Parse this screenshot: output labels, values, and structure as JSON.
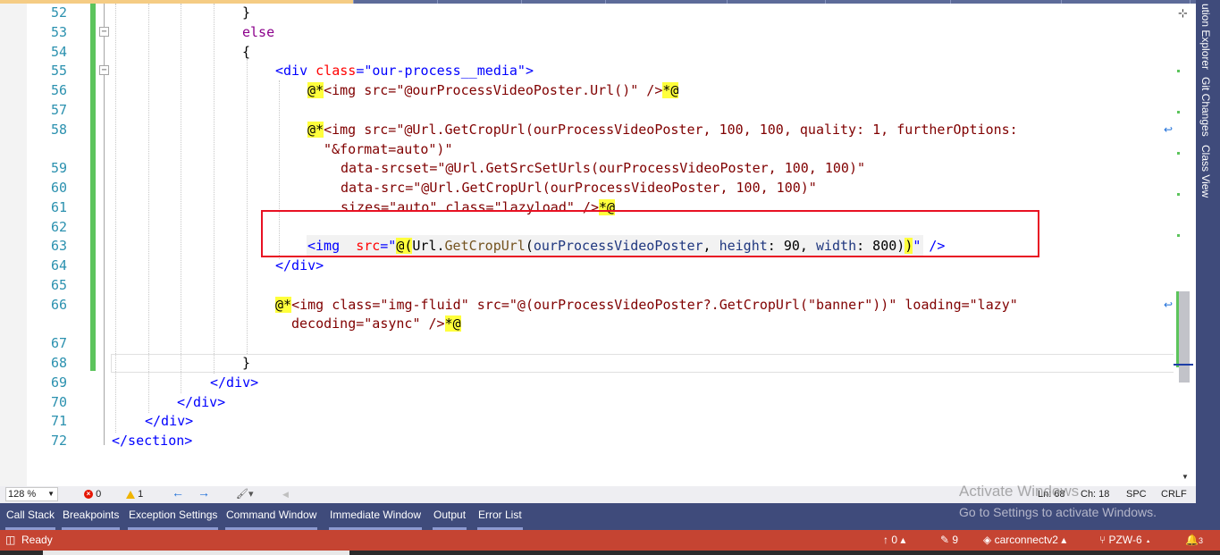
{
  "editor": {
    "line_numbers": [
      "52",
      "53",
      "54",
      "55",
      "56",
      "57",
      "58",
      "59",
      "60",
      "61",
      "62",
      "63",
      "64",
      "65",
      "66",
      "67",
      "68",
      "69",
      "70",
      "71",
      "72"
    ],
    "lines": {
      "l52": {
        "brace": "}"
      },
      "l53": {
        "kw": "else"
      },
      "l54": {
        "brace": "{"
      },
      "l55": {
        "open": "<div",
        "attr": "class",
        "eq": "=",
        "val": "\"our-process__media\"",
        "close": ">"
      },
      "l56": {
        "at": "@*",
        "text": "<img src=\"@ourProcessVideoPoster.Url()\" />",
        "end": "*@"
      },
      "l58a": {
        "at": "@*",
        "text": "<img src=\"@Url.GetCropUrl(ourProcessVideoPoster, 100, 100, quality: 1, furtherOptions:"
      },
      "l58b": {
        "text": "\"&format=auto\")\""
      },
      "l59": {
        "text": "data-srcset=\"@Url.GetSrcSetUrls(ourProcessVideoPoster, 100, 100)\""
      },
      "l60": {
        "text": "data-src=\"@Url.GetCropUrl(ourProcessVideoPoster, 100, 100)\""
      },
      "l61": {
        "text": "sizes=\"auto\" class=\"lazyload\" />",
        "end": "*@"
      },
      "l63": {
        "tag": "<img",
        "attr": "src",
        "eq": "=\"",
        "at": "@(",
        "obj": "Url",
        "dot": ".",
        "meth": "GetCropUrl",
        "paren": "(",
        "arg": "ourProcessVideoPoster",
        "comma1": ", ",
        "p1": "height",
        "colon1": ": 90, ",
        "p2": "width",
        "colon2": ": 800)",
        "close_paren": ")",
        "quote": "\"",
        "tail": " />"
      },
      "l64": {
        "text": "</div>"
      },
      "l66a": {
        "at": "@*",
        "text": "<img class=\"img-fluid\" src=\"@(ourProcessVideoPoster?.GetCropUrl(\"banner\"))\" loading=\"lazy\""
      },
      "l66b": {
        "text": "decoding=\"async\" />",
        "end": "*@"
      },
      "l68": {
        "brace": "}"
      },
      "l69": {
        "text": "</div>"
      },
      "l70": {
        "text": "</div>"
      },
      "l71": {
        "text": "</div>"
      },
      "l72": {
        "text": "</section>"
      }
    }
  },
  "right_rail": {
    "tabs": [
      "ution Explorer",
      "Git Changes",
      "Class View"
    ]
  },
  "editor_status": {
    "zoom": "128 %",
    "errors": "0",
    "warnings": "1",
    "position_line": "Ln: 68",
    "position_char": "Ch: 18",
    "indent": "SPC",
    "line_ending": "CRLF"
  },
  "tool_tabs": [
    "Call Stack",
    "Breakpoints",
    "Exception Settings",
    "Command Window",
    "Immediate Window",
    "Output",
    "Error List"
  ],
  "watermark": {
    "title": "Activate Windows",
    "subtitle": "Go to Settings to activate Windows."
  },
  "status_bar": {
    "ready": "Ready",
    "push_count": "0",
    "pending_changes": "9",
    "repo": "carconnectv2",
    "branch": "PZW-6",
    "notifications": "3"
  },
  "colors": {
    "accent_status": "#c54432",
    "tool_bar": "#3f4b7b",
    "change_bar": "#5cc45c",
    "annotation_box": "#e81123"
  }
}
